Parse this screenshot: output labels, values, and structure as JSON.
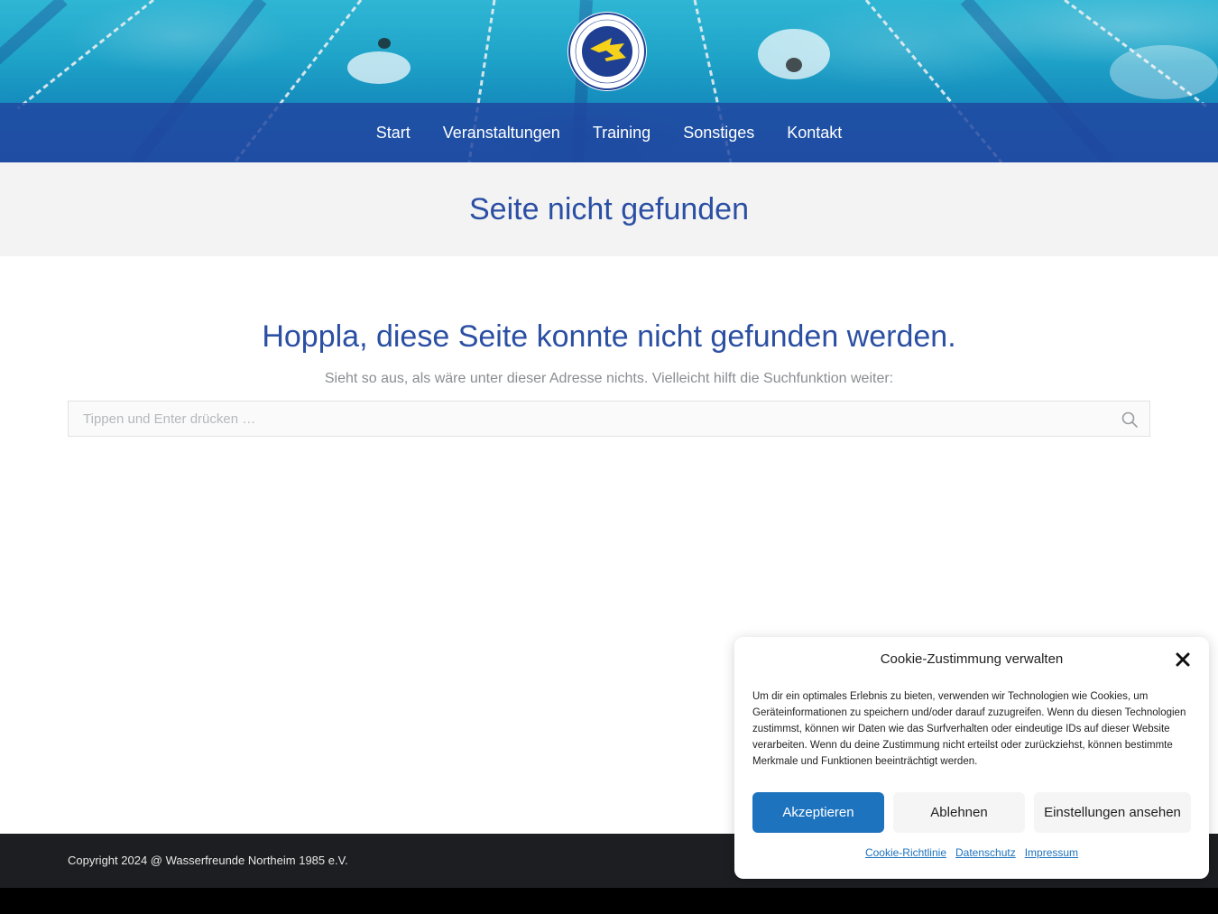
{
  "header": {
    "logo_alt": "Wasserfreunde Northeim logo",
    "nav": [
      {
        "label": "Start"
      },
      {
        "label": "Veranstaltungen"
      },
      {
        "label": "Training"
      },
      {
        "label": "Sonstiges"
      },
      {
        "label": "Kontakt"
      }
    ],
    "colors": {
      "nav_bg": "#2046a0",
      "accent": "#2b4fa3"
    }
  },
  "title_band": {
    "title": "Seite nicht gefunden"
  },
  "main": {
    "heading": "Hoppla, diese Seite konnte nicht gefunden werden.",
    "subtext": "Sieht so aus, als wäre unter dieser Adresse nichts. Vielleicht hilft die Suchfunktion weiter:",
    "search": {
      "placeholder": "Tippen und Enter drücken …",
      "value": "",
      "icon": "search-icon"
    }
  },
  "footer": {
    "copyright": "Copyright 2024 @ Wasserfreunde Northeim 1985 e.V."
  },
  "cookie": {
    "title": "Cookie-Zustimmung verwalten",
    "text": "Um dir ein optimales Erlebnis zu bieten, verwenden wir Technologien wie Cookies, um Geräteinformationen zu speichern und/oder darauf zuzugreifen. Wenn du diesen Technologien zustimmst, können wir Daten wie das Surfverhalten oder eindeutige IDs auf dieser Website verarbeiten. Wenn du deine Zustimmung nicht erteilst oder zurückziehst, können bestimmte Merkmale und Funktionen beeinträchtigt werden.",
    "buttons": {
      "accept": "Akzeptieren",
      "deny": "Ablehnen",
      "settings": "Einstellungen ansehen"
    },
    "links": {
      "policy": "Cookie-Richtlinie",
      "privacy": "Datenschutz",
      "imprint": "Impressum"
    },
    "colors": {
      "accept_bg": "#1e73be"
    }
  }
}
